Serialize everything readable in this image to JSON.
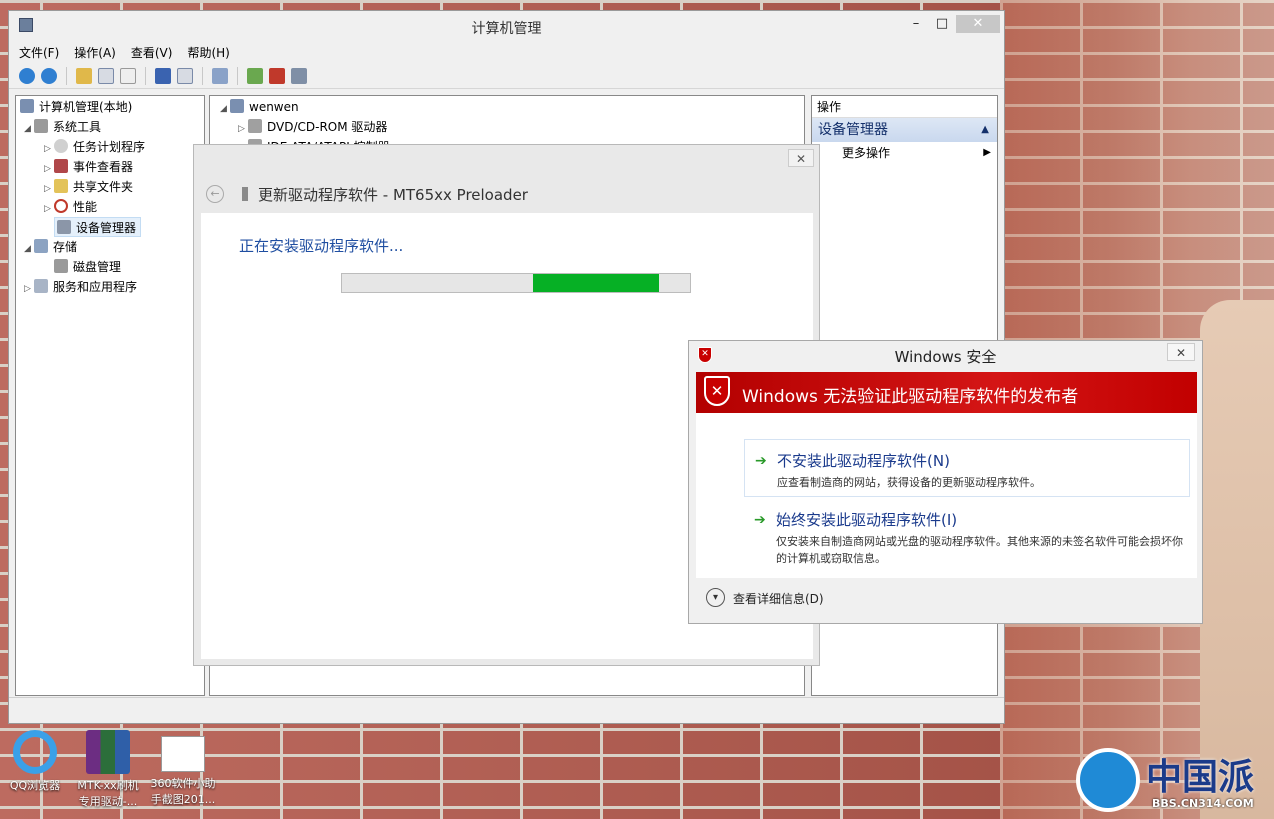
{
  "main_window": {
    "title": "计算机管理",
    "minimize": "–",
    "maximize": "□",
    "close": "✕"
  },
  "menu": [
    "文件(F)",
    "操作(A)",
    "查看(V)",
    "帮助(H)"
  ],
  "toolbar_icons": [
    "back-icon",
    "forward-icon",
    "up-icon",
    "show-hide-tree-icon",
    "properties-icon",
    "help-icon",
    "show-hide-action-icon",
    "scan-hardware-icon",
    "update-driver-icon",
    "uninstall-icon",
    "disable-icon"
  ],
  "tree": {
    "root": "计算机管理(本地)",
    "system_tools": "系统工具",
    "task_scheduler": "任务计划程序",
    "event_viewer": "事件查看器",
    "shared_folders": "共享文件夹",
    "performance": "性能",
    "device_manager": "设备管理器",
    "storage": "存储",
    "disk_management": "磁盘管理",
    "services": "服务和应用程序"
  },
  "devices": {
    "computer": "wenwen",
    "dvd": "DVD/CD-ROM 驱动器",
    "ide": "IDE ATA/ATAPI 控制器"
  },
  "actions": {
    "header": "操作",
    "section": "设备管理器",
    "more": "更多操作"
  },
  "update_dialog": {
    "title": "更新驱动程序软件 - MT65xx Preloader",
    "status": "正在安装驱动程序软件...",
    "close": "✕",
    "progress": {
      "start": 0.55,
      "end": 0.91
    }
  },
  "security_dialog": {
    "title": "Windows 安全",
    "close": "✕",
    "warning": "Windows 无法验证此驱动程序软件的发布者",
    "option1_title": "不安装此驱动程序软件(N)",
    "option1_desc": "应查看制造商的网站，获得设备的更新驱动程序软件。",
    "option2_title": "始终安装此驱动程序软件(I)",
    "option2_desc": "仅安装来自制造商网站或光盘的驱动程序软件。其他来源的未签名软件可能会损坏你的计算机或窃取信息。",
    "details": "查看详细信息(D)"
  },
  "desktop": {
    "qq": "QQ浏览器",
    "mtk1": "MTK-xx刷机",
    "mtk2": "专用驱动-...",
    "sw1": "360软件小助",
    "sw2": "手截图201..."
  },
  "watermark": {
    "logo": "中国派",
    "url": "BBS.CN314.COM"
  }
}
